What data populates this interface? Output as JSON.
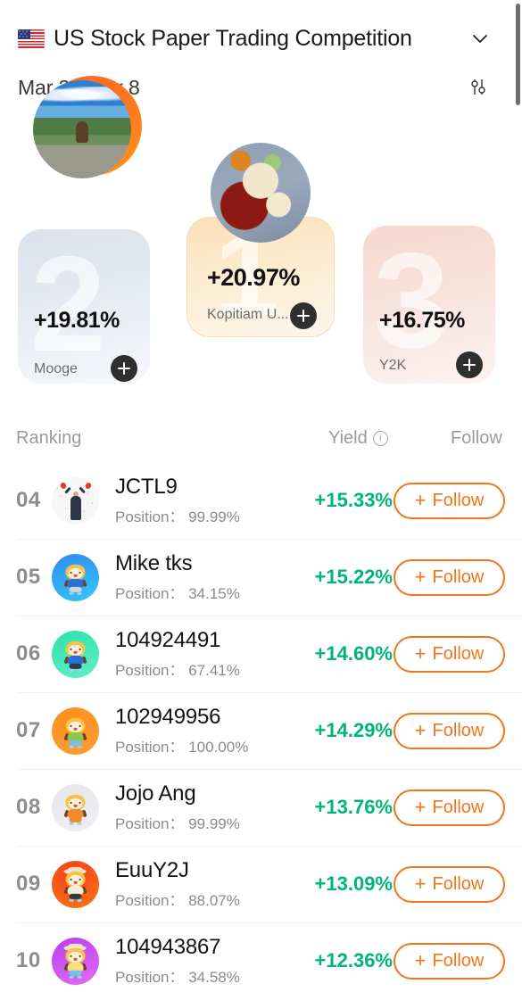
{
  "header": {
    "flag_icon": "us-flag-icon",
    "title": "US Stock Paper Trading Competition",
    "chevron_icon": "chevron-down-icon",
    "date_range": "Mar 3 - Mar 8",
    "filter_icon": "sliders-filter-icon"
  },
  "podium": [
    {
      "rank": "1",
      "yield": "+20.97%",
      "name": "Kopitiam U...",
      "follow_icon": "plus-icon",
      "avatar": "nasi-lemak-photo",
      "accent": "#f6dcb4"
    },
    {
      "rank": "2",
      "yield": "+19.81%",
      "name": "Mooge",
      "follow_icon": "plus-icon",
      "avatar": "orange-bear-mascot",
      "accent": "#dbe2ec"
    },
    {
      "rank": "3",
      "yield": "+16.75%",
      "name": "Y2K",
      "follow_icon": "plus-icon",
      "avatar": "lake-landscape-photo",
      "accent": "#f6d8ce"
    }
  ],
  "list_header": {
    "ranking": "Ranking",
    "yield": "Yield",
    "info_icon": "info-icon",
    "info_glyph": "i",
    "follow": "Follow"
  },
  "position_label": "Position：",
  "follow_button_label": "Follow",
  "follow_button_plus": "+",
  "colors": {
    "yield_green": "#00b578",
    "follow_orange": "#f2751b",
    "rank_gray": "#8d8d8d"
  },
  "rows": [
    {
      "rank": "04",
      "name": "JCTL9",
      "position": "99.99%",
      "yield": "+15.33%",
      "avatar": "celebration-photo",
      "avatar_bg": "#f7f7f7"
    },
    {
      "rank": "05",
      "name": "Mike tks",
      "position": "34.15%",
      "yield": "+15.22%",
      "avatar": "bear-mascot-blue",
      "avatar_bg": "#1f9df0"
    },
    {
      "rank": "06",
      "name": "104924491",
      "position": "67.41%",
      "yield": "+14.60%",
      "avatar": "bear-mascot-teal",
      "avatar_bg": "#3ee0b0"
    },
    {
      "rank": "07",
      "name": "102949956",
      "position": "100.00%",
      "yield": "+14.29%",
      "avatar": "bear-mascot-orange",
      "avatar_bg": "#f57f22"
    },
    {
      "rank": "08",
      "name": "Jojo Ang",
      "position": "99.99%",
      "yield": "+13.76%",
      "avatar": "bear-mascot-gray",
      "avatar_bg": "#e4e3ea"
    },
    {
      "rank": "09",
      "name": "EuuY2J",
      "position": "88.07%",
      "yield": "+13.09%",
      "avatar": "bear-mascot-red",
      "avatar_bg": "#f0481f"
    },
    {
      "rank": "10",
      "name": "104943867",
      "position": "34.58%",
      "yield": "+12.36%",
      "avatar": "bear-mascot-purple",
      "avatar_bg": "#c24ae8"
    }
  ]
}
